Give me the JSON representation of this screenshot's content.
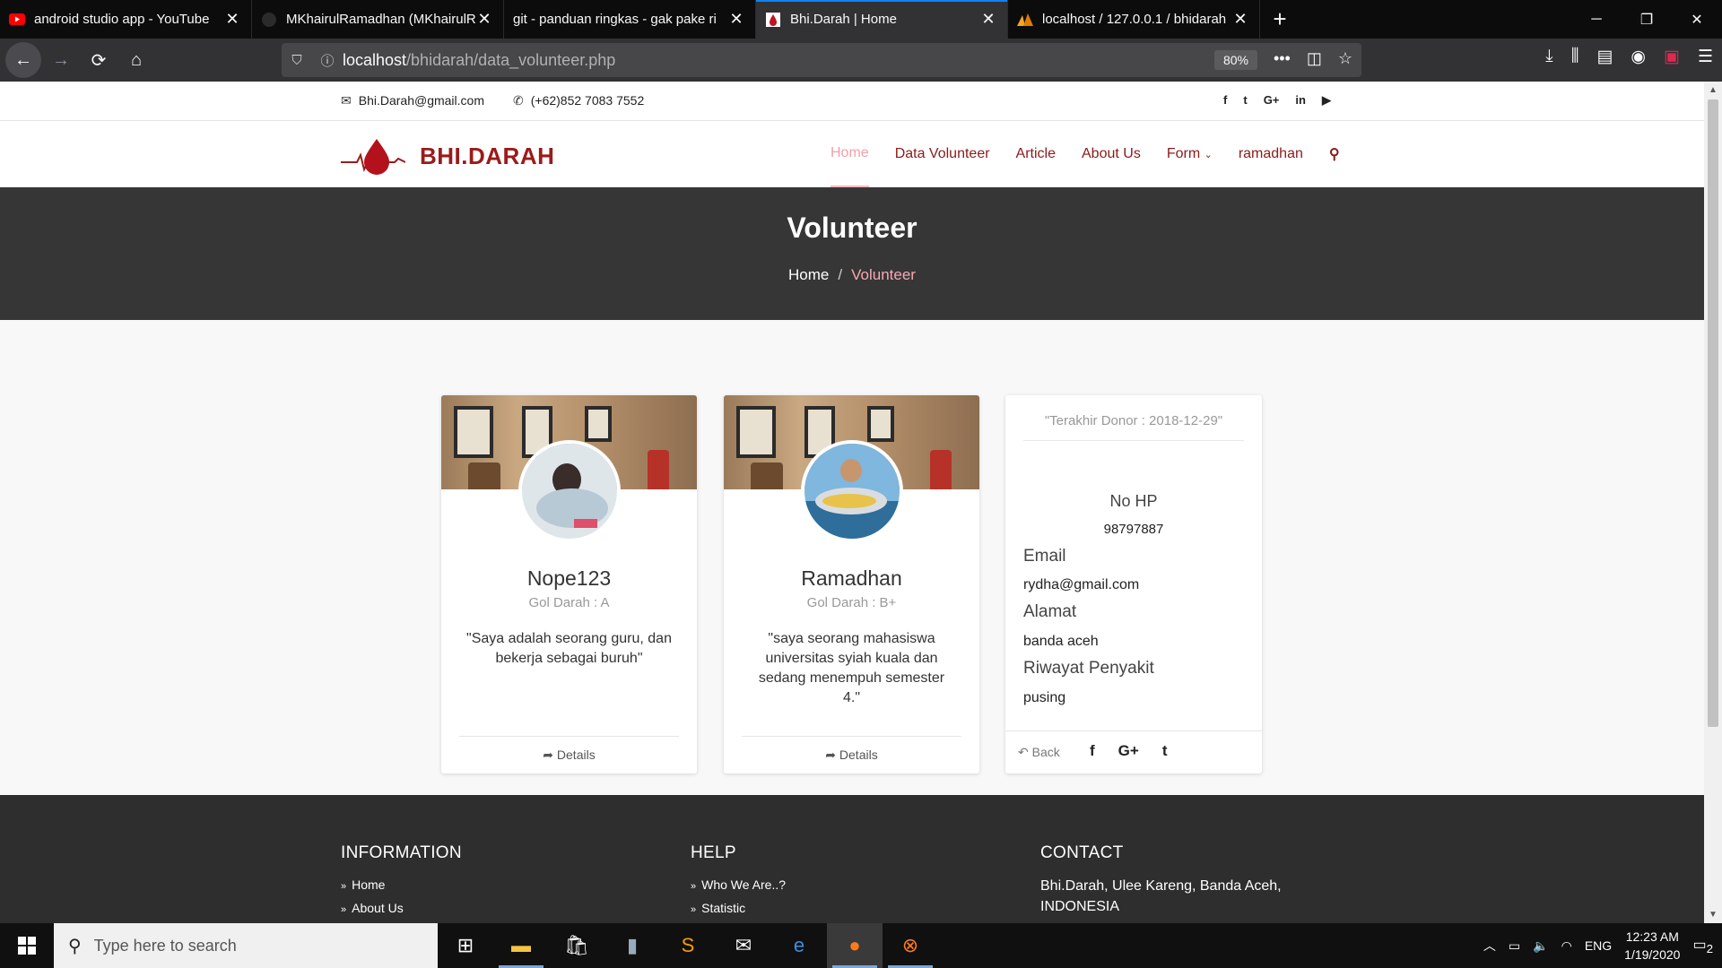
{
  "browser": {
    "tabs": [
      {
        "title": "android studio app - YouTube",
        "favicon": "youtube-icon",
        "active": false
      },
      {
        "title": "MKhairulRamadhan (MKhairulR",
        "favicon": "github-icon",
        "active": false
      },
      {
        "title": "git - panduan ringkas - gak pake ri",
        "favicon": "",
        "active": false
      },
      {
        "title": "Bhi.Darah | Home",
        "favicon": "bhidarah-icon",
        "active": true
      },
      {
        "title": "localhost / 127.0.0.1 / bhidarah",
        "favicon": "phpmyadmin-icon",
        "active": false
      }
    ],
    "url_host": "localhost",
    "url_path": "/bhidarah/data_volunteer.php",
    "zoom": "80%"
  },
  "topinfo": {
    "email": "Bhi.Darah@gmail.com",
    "phone": "(+62)852 7083 7552"
  },
  "brand": "BHI.DARAH",
  "menu": [
    "Home",
    "Data Volunteer",
    "Article",
    "About Us",
    "Form",
    "ramadhan"
  ],
  "banner": {
    "title": "Volunteer",
    "crumb_home": "Home",
    "crumb_current": "Volunteer"
  },
  "volunteers": [
    {
      "name": "Nope123",
      "blood": "Gol Darah : A",
      "quote": "\"Saya adalah seorang guru, dan bekerja sebagai buruh\"",
      "details": "Details"
    },
    {
      "name": "Ramadhan",
      "blood": "Gol Darah : B+",
      "quote": "\"saya seorang mahasiswa universitas syiah kuala dan sedang menempuh semester 4.\"",
      "details": "Details"
    }
  ],
  "info": {
    "last_donor": "\"Terakhir Donor : 2018-12-29\"",
    "phone_label": "No HP",
    "phone_value": "98797887",
    "email_label": "Email",
    "email_value": "rydha@gmail.com",
    "address_label": "Alamat",
    "address_value": "banda aceh",
    "history_label": "Riwayat Penyakit",
    "history_value": "pusing",
    "back": "Back"
  },
  "footer": {
    "information": {
      "title": "INFORMATION",
      "items": [
        "Home",
        "About Us"
      ]
    },
    "help": {
      "title": "HELP",
      "items": [
        "Who We Are..?",
        "Statistic"
      ]
    },
    "contact": {
      "title": "CONTACT",
      "address": "Bhi.Darah, Ulee Kareng, Banda Aceh, INDONESIA"
    }
  },
  "taskbar": {
    "search_placeholder": "Type here to search",
    "lang": "ENG",
    "time": "12:23 AM",
    "date": "1/19/2020",
    "notifications": "2"
  },
  "colors": {
    "brand": "#9b1b1b",
    "menu_active": "#f2a0a8",
    "banner_bg": "#363636",
    "footer_bg": "#2e2e2e"
  }
}
